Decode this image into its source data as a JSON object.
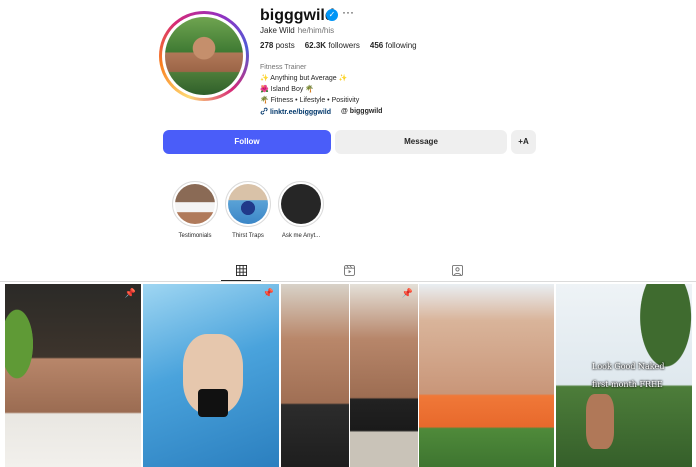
{
  "profile": {
    "username": "bigggwild",
    "full_name": "Jake Wild",
    "pronouns": "he/him/his",
    "posts_count": "278",
    "posts_label": "posts",
    "followers_count": "62.3K",
    "followers_label": "followers",
    "following_count": "456",
    "following_label": "following",
    "category": "Fitness Trainer",
    "bio_lines": [
      "✨ Anything but Average ✨",
      "🌺 Island Boy 🌴",
      "🌴 Fitness • Lifestyle • Positivity"
    ],
    "link": "linktr.ee/bigggwild",
    "threads_handle": "bigggwild"
  },
  "actions": {
    "follow": "Follow",
    "message": "Message",
    "suggest": "+A"
  },
  "highlights": [
    {
      "label": "Testimonials"
    },
    {
      "label": "Thirst Traps"
    },
    {
      "label": "Ask me Anyt..."
    }
  ],
  "grid_overlay_lines": [
    "Look Good Naked",
    "first month FREE"
  ],
  "colors": {
    "follow_button": "#4a5df9",
    "secondary_button": "#efefef",
    "link": "#00376b",
    "verified": "#0095f6"
  },
  "icons": {
    "verified": "verified-badge-icon",
    "more": "more-options-icon",
    "link": "link-icon",
    "threads": "threads-icon",
    "posts_tab": "grid-icon",
    "reels_tab": "reels-icon",
    "tagged_tab": "tagged-icon",
    "pin": "pin-icon"
  }
}
